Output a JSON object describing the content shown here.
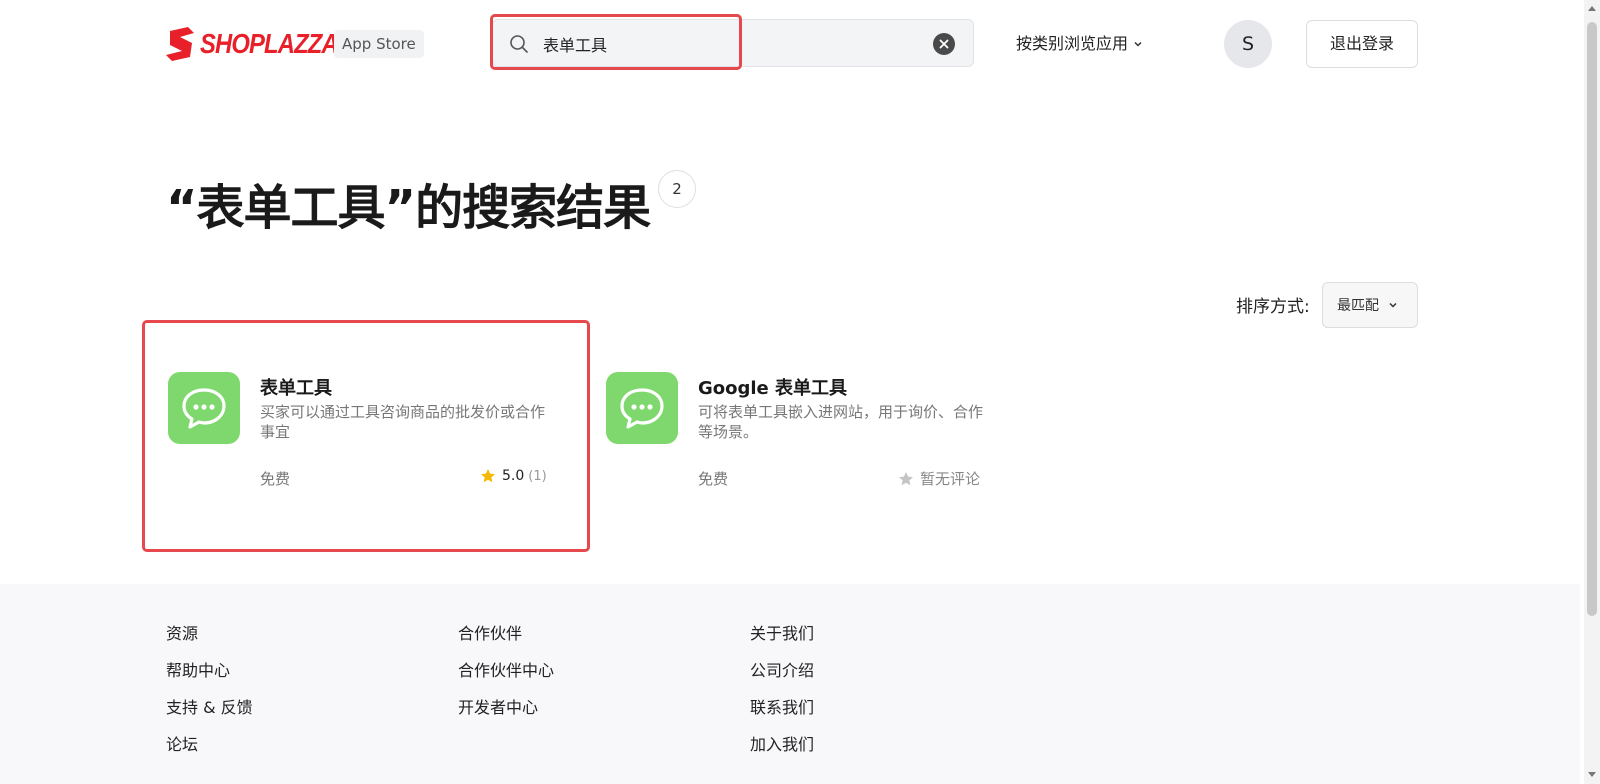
{
  "header": {
    "logo_text": "SHOPLAZZA",
    "badge": "App Store",
    "search": {
      "value": "表单工具",
      "placeholder": ""
    },
    "browse_menu": "按类别浏览应用",
    "avatar_initial": "S",
    "logout": "退出登录"
  },
  "results": {
    "title": "“表单工具”的搜索结果",
    "count": "2"
  },
  "sort": {
    "label": "排序方式:",
    "selected": "最匹配"
  },
  "apps": [
    {
      "name": "表单工具",
      "description": "买家可以通过工具咨询商品的批发价或合作事宜",
      "price": "免费",
      "rating": "5.0",
      "rating_count": "(1)"
    },
    {
      "name": "Google 表单工具",
      "description": "可将表单工具嵌入进网站，用于询价、合作等场景。",
      "price": "免费",
      "no_review": "暂无评论"
    }
  ],
  "footer": {
    "columns": [
      {
        "heading": "资源",
        "links": [
          "帮助中心",
          "支持 & 反馈",
          "论坛"
        ]
      },
      {
        "heading": "合作伙伴",
        "links": [
          "合作伙伴中心",
          "开发者中心"
        ]
      },
      {
        "heading": "关于我们",
        "links": [
          "公司介绍",
          "联系我们",
          "加入我们"
        ]
      }
    ]
  },
  "colors": {
    "brand": "#e8202a",
    "highlight": "#e5484d",
    "app_icon": "#7fd86d",
    "star": "#f5b800"
  }
}
